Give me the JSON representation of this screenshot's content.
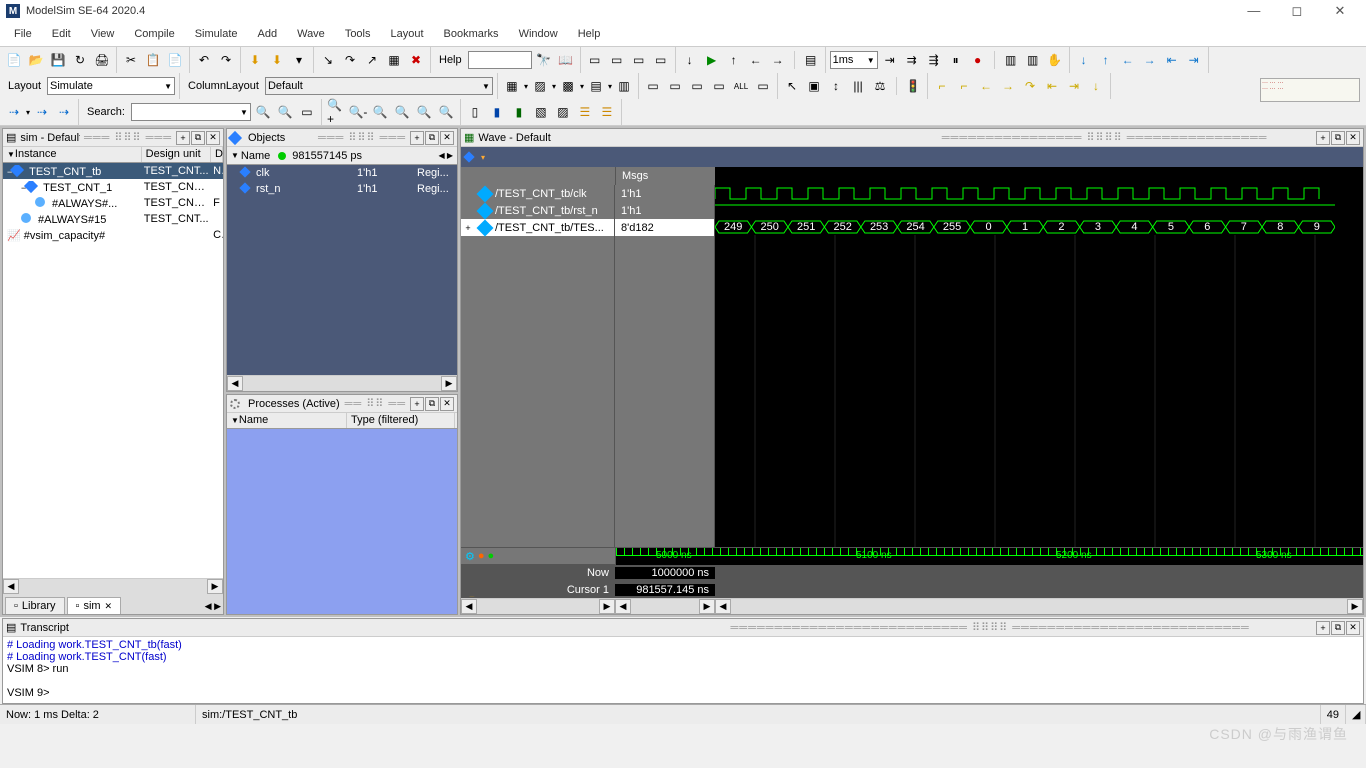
{
  "title": "ModelSim SE-64 2020.4",
  "menu": [
    "File",
    "Edit",
    "View",
    "Compile",
    "Simulate",
    "Add",
    "Wave",
    "Tools",
    "Layout",
    "Bookmarks",
    "Window",
    "Help"
  ],
  "toolbar_row1": {
    "help_label": "Help",
    "time_box": "1ms"
  },
  "toolbar_row2": {
    "layout_label": "Layout",
    "layout_value": "Simulate",
    "columnlayout_label": "ColumnLayout",
    "columnlayout_value": "Default"
  },
  "toolbar_row3": {
    "search_label": "Search:"
  },
  "sim_panel": {
    "title": "sim - Default",
    "cols": [
      "Instance",
      "Design unit",
      "D"
    ],
    "rows": [
      {
        "exp": "−",
        "name": "TEST_CNT_tb",
        "du": "TEST_CNT...",
        "d": "N",
        "icon": "cube",
        "sel": true,
        "indent": 0
      },
      {
        "exp": "−",
        "name": "TEST_CNT_1",
        "du": "TEST_CNT(...",
        "d": "",
        "icon": "cube",
        "indent": 1
      },
      {
        "exp": "",
        "name": "#ALWAYS#...",
        "du": "TEST_CNT(...",
        "d": "F",
        "icon": "glob",
        "indent": 2
      },
      {
        "exp": "",
        "name": "#ALWAYS#15",
        "du": "TEST_CNT...",
        "d": "",
        "icon": "glob",
        "indent": 1
      },
      {
        "exp": "",
        "name": "#vsim_capacity#",
        "du": "",
        "d": "C",
        "icon": "chart",
        "indent": 0
      }
    ],
    "tabs": [
      {
        "label": "Library",
        "icon": "lib"
      },
      {
        "label": "sim",
        "icon": "sim",
        "active": true
      }
    ]
  },
  "objects_panel": {
    "title": "Objects",
    "header_name": "Name",
    "header_time": "981557145 ps",
    "rows": [
      {
        "name": "clk",
        "val": "1'h1",
        "kind": "Regi..."
      },
      {
        "name": "rst_n",
        "val": "1'h1",
        "kind": "Regi..."
      }
    ]
  },
  "processes_panel": {
    "title": "Processes (Active)",
    "cols": [
      "Name",
      "Type (filtered)"
    ]
  },
  "wave_panel": {
    "title": "Wave - Default",
    "name_header": "",
    "msgs_header": "Msgs",
    "signals": [
      {
        "name": "/TEST_CNT_tb/clk",
        "val": "1'h1",
        "type": "clk"
      },
      {
        "name": "/TEST_CNT_tb/rst_n",
        "val": "1'h1",
        "type": "high"
      },
      {
        "name": "/TEST_CNT_tb/TES...",
        "val": "8'd182",
        "type": "bus",
        "sel": true,
        "bus_values": [
          "249",
          "250",
          "251",
          "252",
          "253",
          "254",
          "255",
          "0",
          "1",
          "2",
          "3",
          "4",
          "5",
          "6",
          "7",
          "8",
          "9"
        ]
      }
    ],
    "footer": {
      "now_label": "Now",
      "now_val": "1000000 ns",
      "cur_label": "Cursor 1",
      "cur_val": "981557.145 ns"
    },
    "time_ticks": [
      "5000 ns",
      "5100 ns",
      "5200 ns",
      "5300 ns"
    ]
  },
  "transcript": {
    "title": "Transcript",
    "lines": [
      {
        "text": "# Loading work.TEST_CNT_tb(fast)",
        "cls": "blue"
      },
      {
        "text": "# Loading work.TEST_CNT(fast)",
        "cls": "blue"
      },
      {
        "text": "VSIM 8> run",
        "cls": ""
      },
      {
        "text": "",
        "cls": ""
      },
      {
        "text": "VSIM 9>",
        "cls": ""
      }
    ]
  },
  "status": {
    "left": "Now: 1 ms  Delta: 2",
    "mid": "sim:/TEST_CNT_tb",
    "right": "49"
  },
  "watermark": "CSDN @与雨渔谓鱼"
}
